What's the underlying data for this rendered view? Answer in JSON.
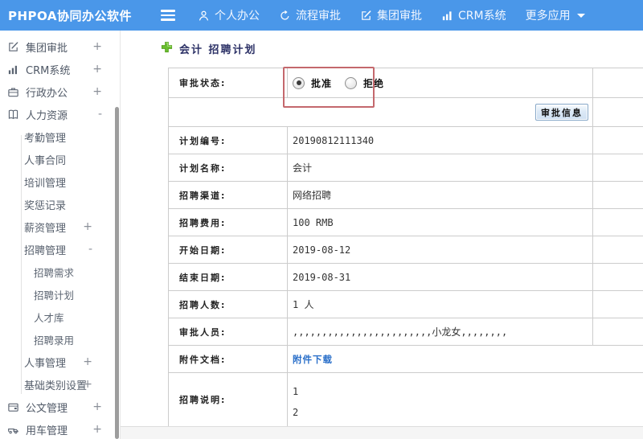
{
  "topbar": {
    "logo": "PHPOA协同办公软件",
    "nav": [
      {
        "label": "个人办公",
        "icon": "user-icon"
      },
      {
        "label": "流程审批",
        "icon": "process-icon"
      },
      {
        "label": "集团审批",
        "icon": "edit-icon"
      },
      {
        "label": "CRM系统",
        "icon": "chart-icon"
      },
      {
        "label": "更多应用",
        "icon": "caret-down-icon"
      }
    ]
  },
  "sidebar": {
    "items": [
      {
        "label": "集团审批",
        "expander": "+",
        "icon": "edit-icon",
        "level": 1
      },
      {
        "label": "CRM系统",
        "expander": "+",
        "icon": "chart-icon",
        "level": 1
      },
      {
        "label": "行政办公",
        "expander": "+",
        "icon": "briefcase-icon",
        "level": 1
      },
      {
        "label": "人力资源",
        "expander": "-",
        "icon": "book-icon",
        "level": 1
      },
      {
        "label": "考勤管理",
        "level": 2
      },
      {
        "label": "人事合同",
        "level": 2
      },
      {
        "label": "培训管理",
        "level": 2
      },
      {
        "label": "奖惩记录",
        "level": 2
      },
      {
        "label": "薪资管理",
        "expander": "+",
        "level": 2
      },
      {
        "label": "招聘管理",
        "expander": "-",
        "level": 2
      },
      {
        "label": "招聘需求",
        "level": 3
      },
      {
        "label": "招聘计划",
        "level": 3
      },
      {
        "label": "人才库",
        "level": 3
      },
      {
        "label": "招聘录用",
        "level": 3
      },
      {
        "label": "人事管理",
        "expander": "+",
        "level": 2
      },
      {
        "label": "基础类别设置",
        "expander": "+",
        "level": 2
      },
      {
        "label": "公文管理",
        "expander": "+",
        "icon": "folder-icon",
        "level": 1
      },
      {
        "label": "用车管理",
        "expander": "+",
        "icon": "car-icon",
        "level": 1
      }
    ]
  },
  "main": {
    "page_title": "会计 招聘计划",
    "status_label": "审批状态:",
    "status_options": [
      {
        "label": "批准",
        "selected": true
      },
      {
        "label": "拒绝",
        "selected": false
      }
    ],
    "approve_info_button": "审批信息",
    "rows": [
      {
        "label": "计划编号:",
        "value": "20190812111340"
      },
      {
        "label": "计划名称:",
        "value": "会计"
      },
      {
        "label": "招聘渠道:",
        "value": "网络招聘"
      },
      {
        "label": "招聘费用:",
        "value": "100 RMB"
      },
      {
        "label": "开始日期:",
        "value": "2019-08-12"
      },
      {
        "label": "结束日期:",
        "value": "2019-08-31"
      },
      {
        "label": "招聘人数:",
        "value": "1 人"
      },
      {
        "label": "审批人员:",
        "value": ",,,,,,,,,,,,,,,,,,,,,,,,小龙女,,,,,,,,"
      },
      {
        "label": "附件文档:",
        "value": "附件下载"
      },
      {
        "label": "招聘说明:",
        "lines": {
          "0": "1",
          "1": "2"
        }
      }
    ]
  },
  "colors": {
    "topbar_blue": "#4a97e9",
    "highlight_red": "#c4686d",
    "link_blue": "#2a6fc9",
    "plus_green": "#6abf30",
    "title_navy": "#2c3166"
  }
}
